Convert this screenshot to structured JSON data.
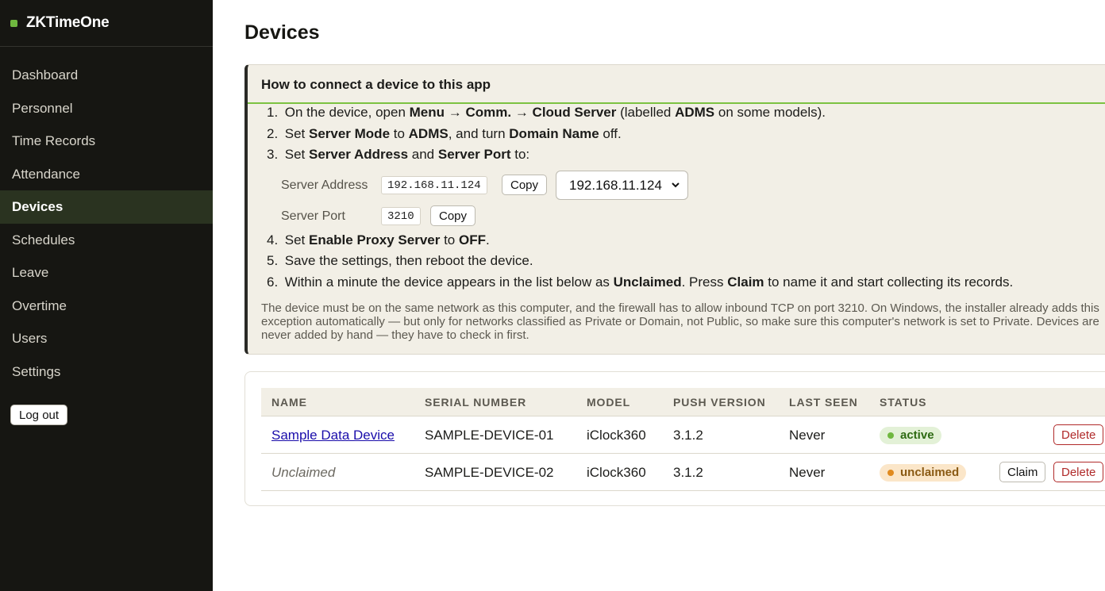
{
  "app": {
    "name": "ZKTimeOne",
    "colors": {
      "accent": "#7cc242",
      "sidebar": "#161612",
      "danger": "#b02a2a"
    }
  },
  "sidebar": {
    "items": [
      {
        "label": "Dashboard"
      },
      {
        "label": "Personnel"
      },
      {
        "label": "Time Records"
      },
      {
        "label": "Attendance"
      },
      {
        "label": "Devices",
        "active": true
      },
      {
        "label": "Schedules"
      },
      {
        "label": "Leave"
      },
      {
        "label": "Overtime"
      },
      {
        "label": "Users"
      },
      {
        "label": "Settings"
      }
    ],
    "logout_label": "Log out"
  },
  "page": {
    "title": "Devices"
  },
  "help": {
    "title": "How to connect a device to this app",
    "steps": [
      {
        "num": "1.",
        "html": "On the device, open <b>Menu</b> → <b>Comm.</b> → <b>Cloud Server</b> (labelled <b>ADMS</b> on some models)."
      },
      {
        "num": "2.",
        "html": "Set <b>Server Mode</b> to <b>ADMS</b>, and turn <b>Domain Name</b> off."
      },
      {
        "num": "3.",
        "html": "Set <b>Server Address</b> and <b>Server Port</b> to:"
      },
      {
        "num": "4.",
        "html": "Set <b>Enable Proxy Server</b> to <b>OFF</b>."
      },
      {
        "num": "5.",
        "html": "Save the settings, then reboot the device."
      },
      {
        "num": "6.",
        "html": "Within a minute the device appears in the list below as <b>Unclaimed</b>. Press <b>Claim</b> to name it and start collecting its records."
      }
    ],
    "server_address_label": "Server Address",
    "server_address_value": "192.168.11.124",
    "server_port_label": "Server Port",
    "server_port_value": "3210",
    "copy_label": "Copy",
    "address_select_value": "192.168.11.124",
    "note": "The device must be on the same network as this computer, and the firewall has to allow inbound TCP on port 3210. On Windows, the installer already adds this exception automatically — but only for networks classified as Private or Domain, not Public, so make sure this computer's network is set to Private. Devices are never added by hand — they have to check in first."
  },
  "table": {
    "columns": [
      "NAME",
      "SERIAL NUMBER",
      "MODEL",
      "PUSH VERSION",
      "LAST SEEN",
      "STATUS"
    ],
    "rows": [
      {
        "name": "Sample Data Device",
        "serial": "SAMPLE-DEVICE-01",
        "model": "iClock360",
        "push_version": "3.1.2",
        "last_seen": "Never",
        "status": "active",
        "claim_label": "",
        "delete_label": "Delete"
      },
      {
        "name": "Unclaimed",
        "serial": "SAMPLE-DEVICE-02",
        "model": "iClock360",
        "push_version": "3.1.2",
        "last_seen": "Never",
        "status": "unclaimed",
        "claim_label": "Claim",
        "delete_label": "Delete"
      }
    ]
  }
}
